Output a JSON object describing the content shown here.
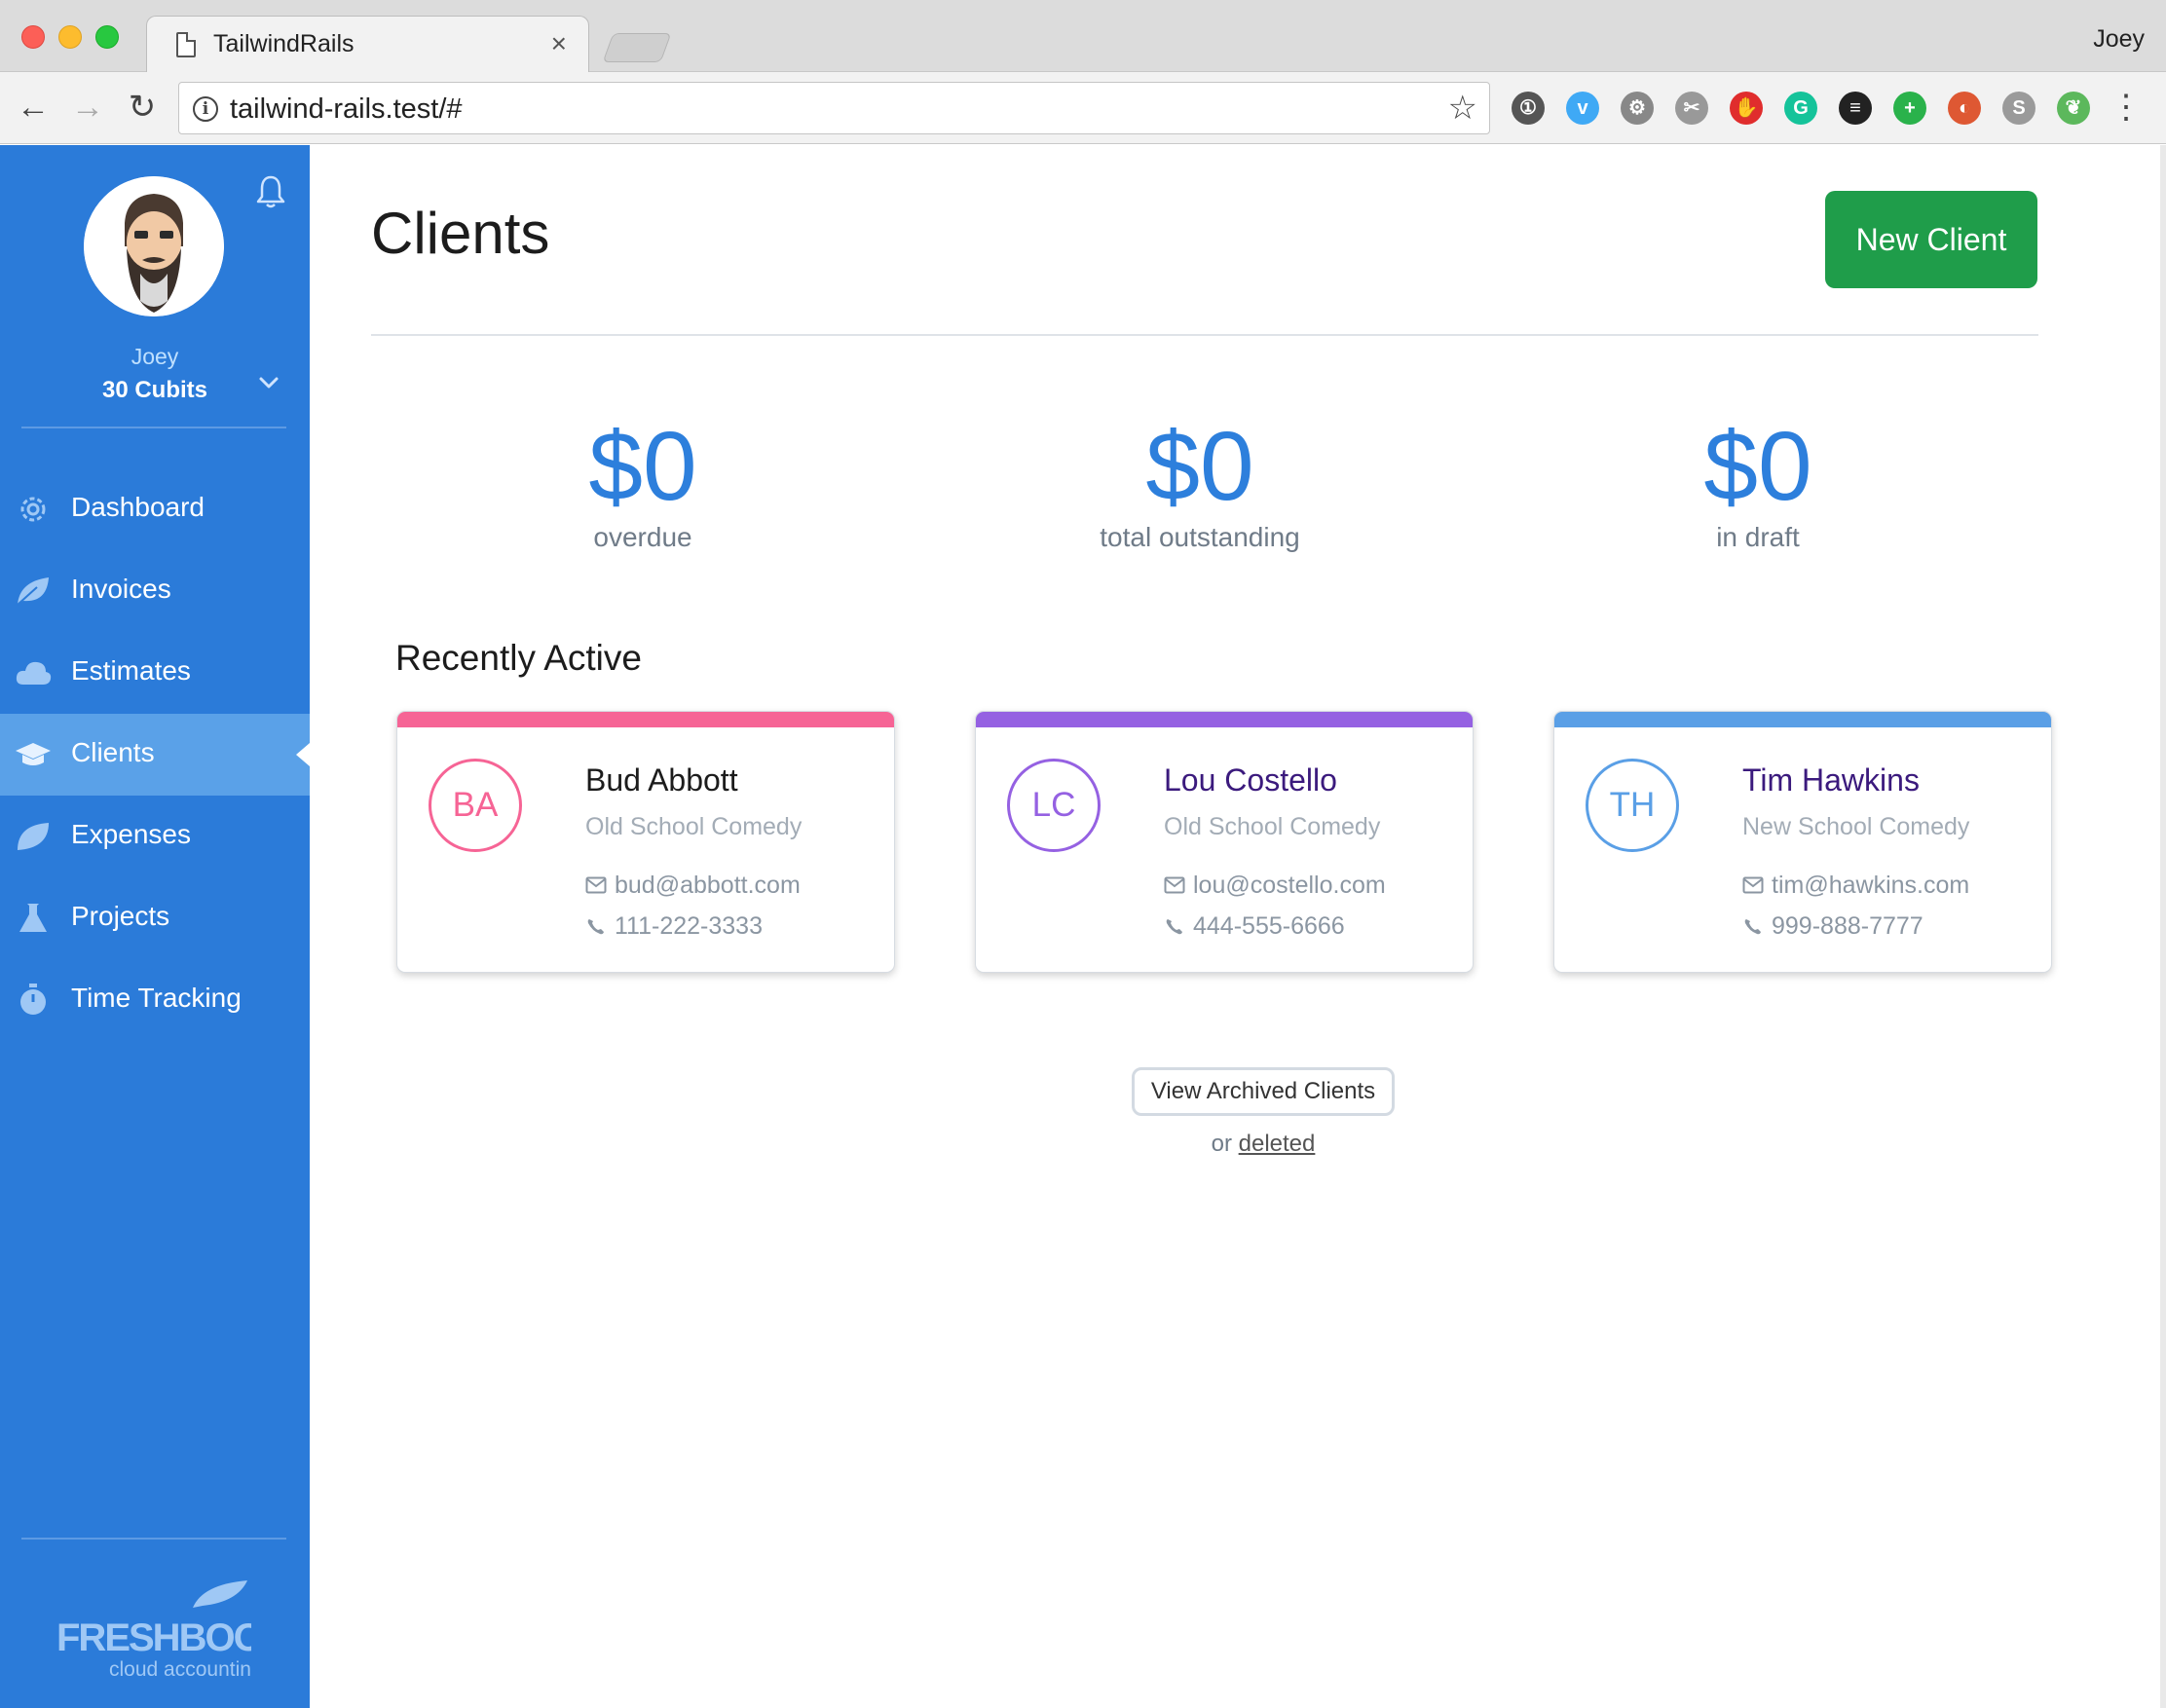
{
  "browser": {
    "tab_title": "TailwindRails",
    "tab_close": "×",
    "profile": "Joey",
    "url": "tailwind-rails.test/#",
    "info_glyph": "i",
    "star_glyph": "☆",
    "back_glyph": "←",
    "forward_glyph": "→",
    "reload_glyph": "↻",
    "menu_glyph": "⋮",
    "extensions": [
      {
        "name": "1password-icon",
        "glyph": "①",
        "color": "#555555"
      },
      {
        "name": "vimeo-icon",
        "glyph": "v",
        "color": "#3fa9f5"
      },
      {
        "name": "settings-extension-icon",
        "glyph": "⚙",
        "color": "#888888"
      },
      {
        "name": "dev-tools-extension-icon",
        "glyph": "✂",
        "color": "#999999"
      },
      {
        "name": "adblock-icon",
        "glyph": "✋",
        "color": "#e02d2d"
      },
      {
        "name": "grammarly-icon",
        "glyph": "G",
        "color": "#15c39a"
      },
      {
        "name": "buffer-icon",
        "glyph": "≡",
        "color": "#222222"
      },
      {
        "name": "plus-extension-icon",
        "glyph": "+",
        "color": "#2ab24b"
      },
      {
        "name": "duckduckgo-icon",
        "glyph": "◐",
        "color": "#de5833"
      },
      {
        "name": "s-extension-icon",
        "glyph": "S",
        "color": "#9a9a9a"
      },
      {
        "name": "leaf-extension-icon",
        "glyph": "❦",
        "color": "#5cb85c"
      }
    ]
  },
  "sidebar": {
    "user_name": "Joey",
    "organization": "30 Cubits",
    "items": [
      {
        "label": "Dashboard",
        "icon": "gear-icon",
        "active": false
      },
      {
        "label": "Invoices",
        "icon": "leaf-icon",
        "active": false
      },
      {
        "label": "Estimates",
        "icon": "cloud-icon",
        "active": false
      },
      {
        "label": "Clients",
        "icon": "graduation-cap-icon",
        "active": true
      },
      {
        "label": "Expenses",
        "icon": "leaf-alt-icon",
        "active": false
      },
      {
        "label": "Projects",
        "icon": "flask-icon",
        "active": false
      },
      {
        "label": "Time Tracking",
        "icon": "stopwatch-icon",
        "active": false
      }
    ],
    "logo_top": "FRESHBOOKS",
    "logo_bottom": "cloud accounting"
  },
  "page": {
    "title": "Clients",
    "new_client_label": "New Client",
    "stats": [
      {
        "amount": "$0",
        "label": "overdue"
      },
      {
        "amount": "$0",
        "label": "total outstanding"
      },
      {
        "amount": "$0",
        "label": "in draft"
      }
    ],
    "recent_title": "Recently Active",
    "clients": [
      {
        "initials": "BA",
        "name": "Bud Abbott",
        "company": "Old School Comedy",
        "email": "bud@abbott.com",
        "phone": "111-222-3333",
        "color": "#f66495",
        "name_color": "#1c1c1c"
      },
      {
        "initials": "LC",
        "name": "Lou Costello",
        "company": "Old School Comedy",
        "email": "lou@costello.com",
        "phone": "444-555-6666",
        "color": "#9561e2",
        "name_color": "#3b1a7d"
      },
      {
        "initials": "TH",
        "name": "Tim Hawkins",
        "company": "New School Comedy",
        "email": "tim@hawkins.com",
        "phone": "999-888-7777",
        "color": "#5a9fe6",
        "name_color": "#3b1a7d"
      }
    ],
    "archived_label": "View Archived Clients",
    "or_label": "or",
    "deleted_label": "deleted"
  },
  "colors": {
    "sidebar": "#2b7bd9",
    "sidebar_active": "#5aa1e8",
    "primary_blue": "#2d7fdc",
    "success_green": "#1f9d4a"
  }
}
